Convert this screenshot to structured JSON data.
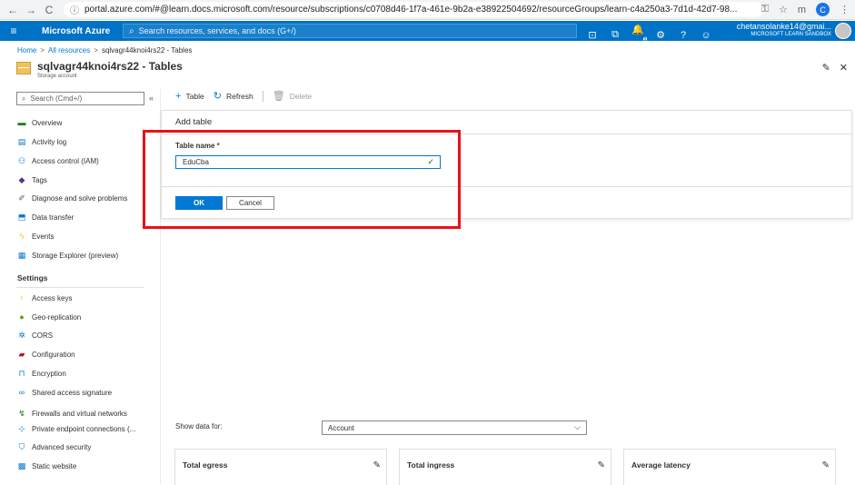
{
  "browser": {
    "url": "portal.azure.com/#@learn.docs.microsoft.com/resource/subscriptions/c0708d46-1f7a-461e-9b2a-e38922504692/resourceGroups/learn-c4a250a3-7d1d-42d7-98...",
    "profile_initial": "C"
  },
  "topbar": {
    "brand": "Microsoft Azure",
    "search_placeholder": "Search resources, services, and docs (G+/)",
    "notification_count": "1",
    "account_email": "chetansolanke14@gmai...",
    "account_directory": "MICROSOFT LEARN SANDBOX"
  },
  "breadcrumb": {
    "home": "Home",
    "all_resources": "All resources",
    "current": "sqlvagr44knoi4rs22 - Tables"
  },
  "resource": {
    "title": "sqlvagr44knoi4rs22 - Tables",
    "subtitle": "Storage account"
  },
  "sidebar": {
    "search_placeholder": "Search (Cmd+/)",
    "items": [
      {
        "label": "Overview",
        "icon": "overview-icon"
      },
      {
        "label": "Activity log",
        "icon": "activity-log-icon"
      },
      {
        "label": "Access control (IAM)",
        "icon": "people-icon"
      },
      {
        "label": "Tags",
        "icon": "tag-icon"
      },
      {
        "label": "Diagnose and solve problems",
        "icon": "wrench-icon"
      },
      {
        "label": "Data transfer",
        "icon": "data-transfer-icon"
      },
      {
        "label": "Events",
        "icon": "lightning-icon"
      },
      {
        "label": "Storage Explorer (preview)",
        "icon": "storage-explorer-icon"
      }
    ],
    "settings_heading": "Settings",
    "settings_items": [
      {
        "label": "Access keys",
        "icon": "key-icon"
      },
      {
        "label": "Geo-replication",
        "icon": "globe-icon"
      },
      {
        "label": "CORS",
        "icon": "cors-icon"
      },
      {
        "label": "Configuration",
        "icon": "briefcase-icon"
      },
      {
        "label": "Encryption",
        "icon": "lock-icon"
      },
      {
        "label": "Shared access signature",
        "icon": "link-icon"
      },
      {
        "label": "Firewalls and virtual networks",
        "icon": "firewall-icon"
      },
      {
        "label": "Private endpoint connections (...",
        "icon": "endpoint-icon"
      },
      {
        "label": "Advanced security",
        "icon": "shield-icon"
      },
      {
        "label": "Static website",
        "icon": "website-icon"
      }
    ]
  },
  "toolbar": {
    "add_table": "Table",
    "refresh": "Refresh",
    "delete": "Delete"
  },
  "add_table_panel": {
    "heading": "Add table",
    "field_label": "Table name",
    "required_marker": "*",
    "field_value": "EduCba",
    "ok_label": "OK",
    "cancel_label": "Cancel"
  },
  "monitoring": {
    "show_data_label": "Show data for:",
    "show_data_value": "Account",
    "cards": [
      "Total egress",
      "Total ingress",
      "Average latency"
    ]
  },
  "colors": {
    "azure_blue": "#0072c6",
    "primary": "#0078d4",
    "highlight": "#e8111a"
  }
}
